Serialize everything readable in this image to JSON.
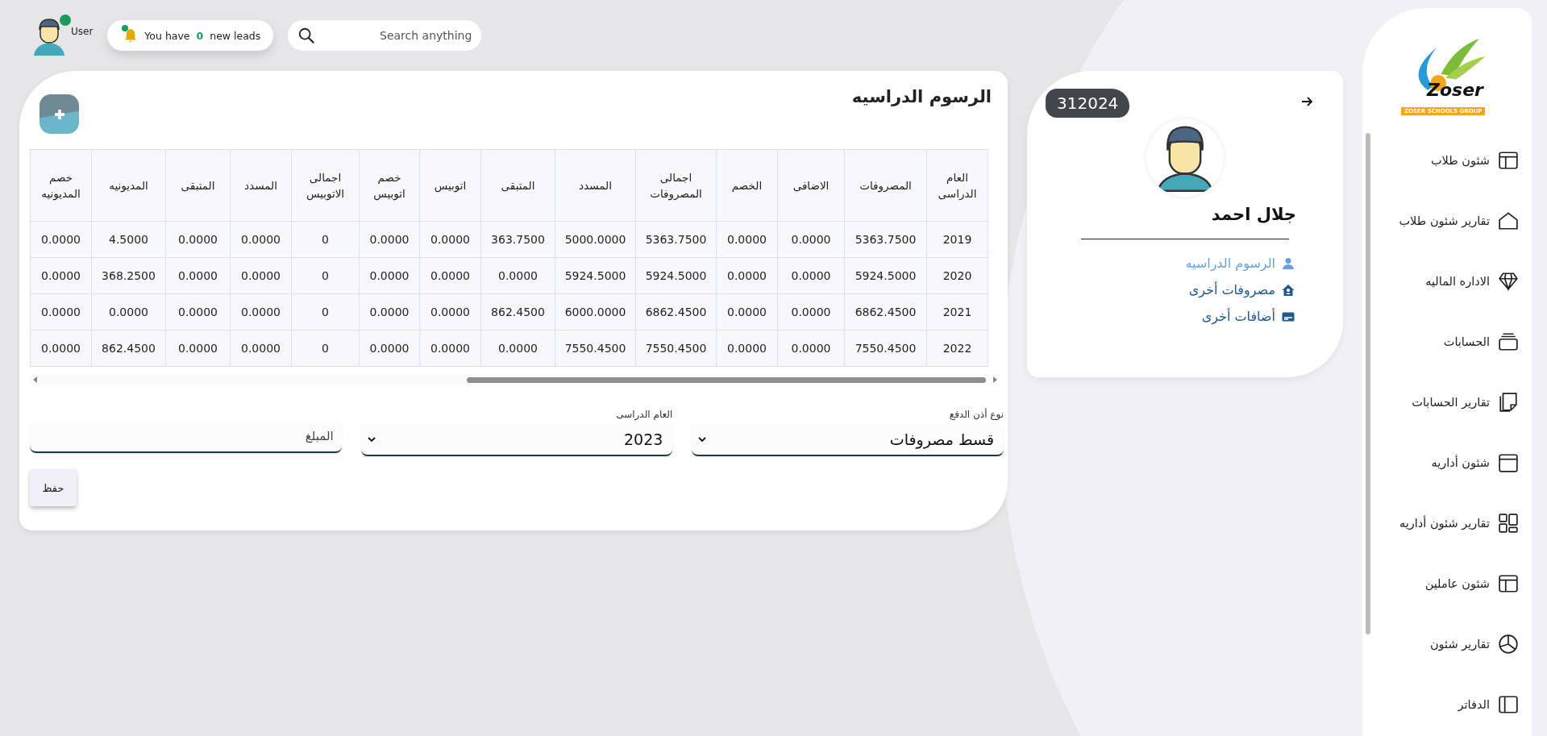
{
  "topbar": {
    "user": {
      "name": "User",
      "online": true
    },
    "leads": {
      "text": "You have **0** new leads",
      "unread": true
    },
    "search": {
      "placeholder": "Search anything"
    }
  },
  "fees_card": {
    "title": "الرسوم الدراسيه",
    "table": {
      "columns": [
        "العام الدراسى",
        "المصروفات",
        "الاضافى",
        "الخصم",
        "اجمالى المصروفات",
        "المسدد",
        "المتبقى",
        "اتوبيس",
        "خصم اتوبيس",
        "اجمالى الاتوبيس",
        "المسدد",
        "المتبقى",
        "المديونيه",
        "خصم المديونيه"
      ],
      "rows": [
        [
          "2019",
          "5363.7500",
          "0.0000",
          "0.0000",
          "5363.7500",
          "5000.0000",
          "363.7500",
          "0.0000",
          "0.0000",
          "0",
          "0.0000",
          "0.0000",
          "4.5000",
          "0.0000"
        ],
        [
          "2020",
          "5924.5000",
          "0.0000",
          "0.0000",
          "5924.5000",
          "5924.5000",
          "0.0000",
          "0.0000",
          "0.0000",
          "0",
          "0.0000",
          "0.0000",
          "368.2500",
          "0.0000"
        ],
        [
          "2021",
          "6862.4500",
          "0.0000",
          "0.0000",
          "6862.4500",
          "6000.0000",
          "862.4500",
          "0.0000",
          "0.0000",
          "0",
          "0.0000",
          "0.0000",
          "0.0000",
          "0.0000"
        ],
        [
          "2022",
          "7550.4500",
          "0.0000",
          "0.0000",
          "7550.4500",
          "7550.4500",
          "0.0000",
          "0.0000",
          "0.0000",
          "0",
          "0.0000",
          "0.0000",
          "862.4500",
          "0.0000"
        ]
      ]
    },
    "form": [
      {
        "kind": "select",
        "label": "نوع أذن الدفع",
        "value": "قسط مصروفات"
      },
      {
        "kind": "select",
        "label": "العام الدراسى",
        "value": "2023"
      },
      {
        "kind": "input",
        "placeholder": "المبلغ"
      }
    ],
    "save_button": "حفظ"
  },
  "student_card": {
    "code": "312024",
    "name": "جلال احمد",
    "links": [
      {
        "label": "الرسوم الدراسيه",
        "selected": true
      },
      {
        "label": "مصروفات أخرى",
        "selected": false
      },
      {
        "label": "أضافات أخرى",
        "selected": false
      }
    ]
  },
  "sidebar": {
    "logo": {
      "name": "Zoser",
      "tagline": "ZOSER SCHOOLS GROUP"
    },
    "items": [
      {
        "label": "شئون طلاب"
      },
      {
        "label": "تقارير شئون طلاب"
      },
      {
        "label": "الاداره الماليه"
      },
      {
        "label": "الحسابات"
      },
      {
        "label": "تقارير الحسابات"
      },
      {
        "label": "شئون أداريه"
      },
      {
        "label": "تقارير شئون أداريه"
      },
      {
        "label": "شئون عاملين"
      },
      {
        "label": "تقارير شئون"
      },
      {
        "label": "الدفاتر"
      }
    ]
  }
}
